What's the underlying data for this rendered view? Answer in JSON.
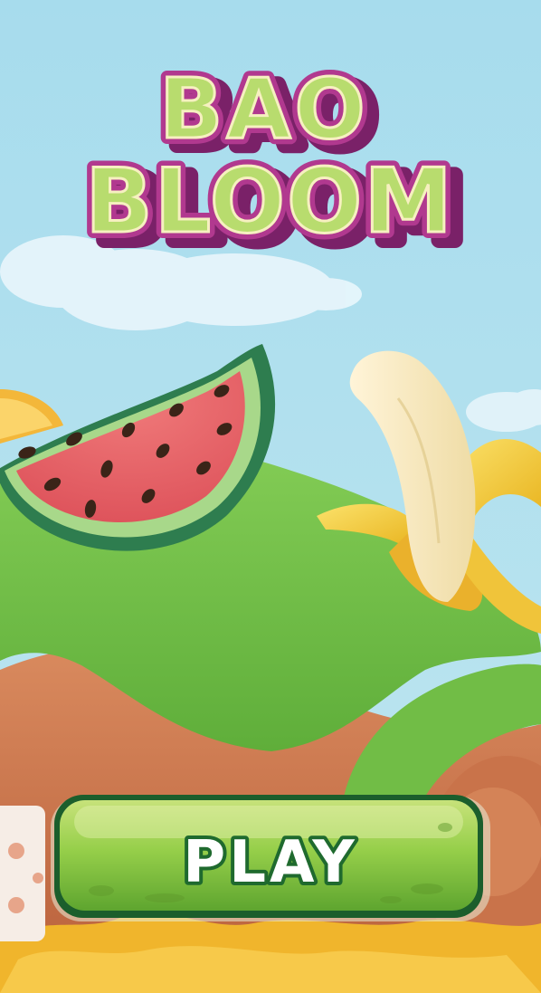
{
  "title": {
    "line1": "BAO",
    "line2": "BLOOM"
  },
  "play_button": {
    "label": "PLAY"
  },
  "colors": {
    "sky": "#a9dced",
    "title_fill": "#b6d96b",
    "title_shadow": "#8d2a7a",
    "hill_green": "#7cc94e",
    "dirt": "#c8714a",
    "button_green": "#7dc23a",
    "button_border": "#1d6b2f",
    "juice": "#f2b22a"
  },
  "icons": [
    "watermelon-slice-icon",
    "banana-icon",
    "cloud-icon",
    "orange-slice-icon"
  ]
}
